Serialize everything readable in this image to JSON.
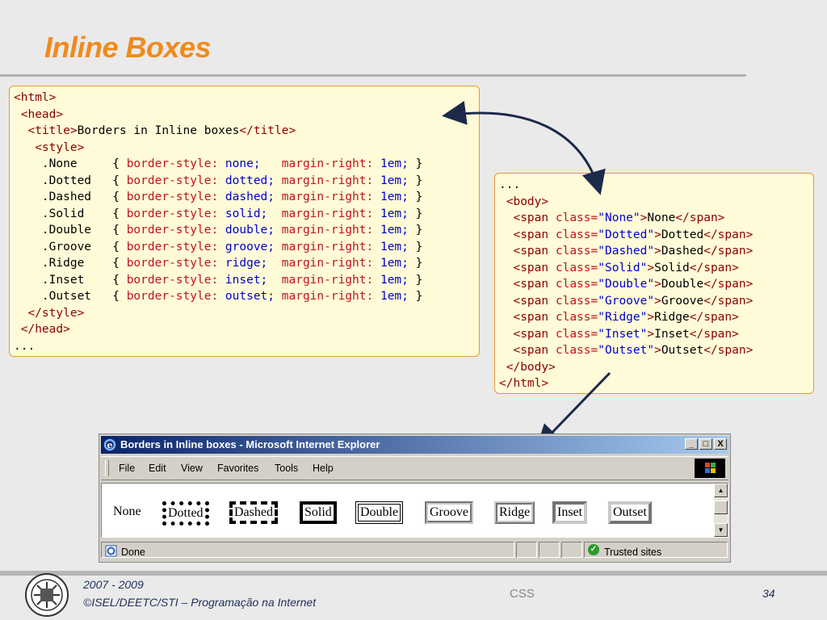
{
  "slide": {
    "title": "Inline Boxes"
  },
  "code_left": [
    [
      [
        "tag",
        "<html>"
      ]
    ],
    [
      [
        "pl",
        " "
      ],
      [
        "tag",
        "<head>"
      ]
    ],
    [
      [
        "pl",
        "  "
      ],
      [
        "tag",
        "<title>"
      ],
      [
        "txt",
        "Borders in Inline boxes"
      ],
      [
        "tag",
        "</title>"
      ]
    ],
    [
      [
        "pl",
        "   "
      ],
      [
        "tag",
        "<style>"
      ]
    ],
    [
      [
        "pl",
        "    .None     { "
      ],
      [
        "attr",
        "border-style: "
      ],
      [
        "val",
        "none;   "
      ],
      [
        "attr",
        "margin-right: "
      ],
      [
        "val",
        "1em;"
      ],
      [
        "pl",
        " }"
      ]
    ],
    [
      [
        "pl",
        "    .Dotted   { "
      ],
      [
        "attr",
        "border-style: "
      ],
      [
        "val",
        "dotted; "
      ],
      [
        "attr",
        "margin-right: "
      ],
      [
        "val",
        "1em;"
      ],
      [
        "pl",
        " }"
      ]
    ],
    [
      [
        "pl",
        "    .Dashed   { "
      ],
      [
        "attr",
        "border-style: "
      ],
      [
        "val",
        "dashed; "
      ],
      [
        "attr",
        "margin-right: "
      ],
      [
        "val",
        "1em;"
      ],
      [
        "pl",
        " }"
      ]
    ],
    [
      [
        "pl",
        "    .Solid    { "
      ],
      [
        "attr",
        "border-style: "
      ],
      [
        "val",
        "solid;  "
      ],
      [
        "attr",
        "margin-right: "
      ],
      [
        "val",
        "1em;"
      ],
      [
        "pl",
        " }"
      ]
    ],
    [
      [
        "pl",
        "    .Double   { "
      ],
      [
        "attr",
        "border-style: "
      ],
      [
        "val",
        "double; "
      ],
      [
        "attr",
        "margin-right: "
      ],
      [
        "val",
        "1em;"
      ],
      [
        "pl",
        " }"
      ]
    ],
    [
      [
        "pl",
        "    .Groove   { "
      ],
      [
        "attr",
        "border-style: "
      ],
      [
        "val",
        "groove; "
      ],
      [
        "attr",
        "margin-right: "
      ],
      [
        "val",
        "1em;"
      ],
      [
        "pl",
        " }"
      ]
    ],
    [
      [
        "pl",
        "    .Ridge    { "
      ],
      [
        "attr",
        "border-style: "
      ],
      [
        "val",
        "ridge;  "
      ],
      [
        "attr",
        "margin-right: "
      ],
      [
        "val",
        "1em;"
      ],
      [
        "pl",
        " }"
      ]
    ],
    [
      [
        "pl",
        "    .Inset    { "
      ],
      [
        "attr",
        "border-style: "
      ],
      [
        "val",
        "inset;  "
      ],
      [
        "attr",
        "margin-right: "
      ],
      [
        "val",
        "1em;"
      ],
      [
        "pl",
        " }"
      ]
    ],
    [
      [
        "pl",
        "    .Outset   { "
      ],
      [
        "attr",
        "border-style: "
      ],
      [
        "val",
        "outset; "
      ],
      [
        "attr",
        "margin-right: "
      ],
      [
        "val",
        "1em;"
      ],
      [
        "pl",
        " }"
      ]
    ],
    [
      [
        "pl",
        "  "
      ],
      [
        "tag",
        "</style>"
      ]
    ],
    [
      [
        "pl",
        " "
      ],
      [
        "tag",
        "</head>"
      ]
    ],
    [
      [
        "pl",
        "..."
      ]
    ]
  ],
  "code_right": [
    [
      [
        "pl",
        "..."
      ]
    ],
    [
      [
        "pl",
        " "
      ],
      [
        "tag",
        "<body>"
      ]
    ],
    [
      [
        "pl",
        "  "
      ],
      [
        "tag",
        "<span "
      ],
      [
        "attr",
        "class="
      ],
      [
        "val",
        "\"None\""
      ],
      [
        "tag",
        ">"
      ],
      [
        "txt",
        "None"
      ],
      [
        "tag",
        "</span>"
      ]
    ],
    [
      [
        "pl",
        "  "
      ],
      [
        "tag",
        "<span "
      ],
      [
        "attr",
        "class="
      ],
      [
        "val",
        "\"Dotted\""
      ],
      [
        "tag",
        ">"
      ],
      [
        "txt",
        "Dotted"
      ],
      [
        "tag",
        "</span>"
      ]
    ],
    [
      [
        "pl",
        "  "
      ],
      [
        "tag",
        "<span "
      ],
      [
        "attr",
        "class="
      ],
      [
        "val",
        "\"Dashed\""
      ],
      [
        "tag",
        ">"
      ],
      [
        "txt",
        "Dashed"
      ],
      [
        "tag",
        "</span>"
      ]
    ],
    [
      [
        "pl",
        "  "
      ],
      [
        "tag",
        "<span "
      ],
      [
        "attr",
        "class="
      ],
      [
        "val",
        "\"Solid\""
      ],
      [
        "tag",
        ">"
      ],
      [
        "txt",
        "Solid"
      ],
      [
        "tag",
        "</span>"
      ]
    ],
    [
      [
        "pl",
        "  "
      ],
      [
        "tag",
        "<span "
      ],
      [
        "attr",
        "class="
      ],
      [
        "val",
        "\"Double\""
      ],
      [
        "tag",
        ">"
      ],
      [
        "txt",
        "Double"
      ],
      [
        "tag",
        "</span>"
      ]
    ],
    [
      [
        "pl",
        "  "
      ],
      [
        "tag",
        "<span "
      ],
      [
        "attr",
        "class="
      ],
      [
        "val",
        "\"Groove\""
      ],
      [
        "tag",
        ">"
      ],
      [
        "txt",
        "Groove"
      ],
      [
        "tag",
        "</span>"
      ]
    ],
    [
      [
        "pl",
        "  "
      ],
      [
        "tag",
        "<span "
      ],
      [
        "attr",
        "class="
      ],
      [
        "val",
        "\"Ridge\""
      ],
      [
        "tag",
        ">"
      ],
      [
        "txt",
        "Ridge"
      ],
      [
        "tag",
        "</span>"
      ]
    ],
    [
      [
        "pl",
        "  "
      ],
      [
        "tag",
        "<span "
      ],
      [
        "attr",
        "class="
      ],
      [
        "val",
        "\"Inset\""
      ],
      [
        "tag",
        ">"
      ],
      [
        "txt",
        "Inset"
      ],
      [
        "tag",
        "</span>"
      ]
    ],
    [
      [
        "pl",
        "  "
      ],
      [
        "tag",
        "<span "
      ],
      [
        "attr",
        "class="
      ],
      [
        "val",
        "\"Outset\""
      ],
      [
        "tag",
        ">"
      ],
      [
        "txt",
        "Outset"
      ],
      [
        "tag",
        "</span>"
      ]
    ],
    [
      [
        "pl",
        " "
      ],
      [
        "tag",
        "</body>"
      ]
    ],
    [
      [
        "tag",
        "</html>"
      ]
    ]
  ],
  "browser": {
    "title": "Borders in Inline boxes - Microsoft Internet Explorer",
    "window_buttons": {
      "minimize": "_",
      "maximize": "□",
      "close": "X"
    },
    "menu": [
      "File",
      "Edit",
      "View",
      "Favorites",
      "Tools",
      "Help"
    ],
    "demo": {
      "none": "None",
      "dotted": "Dotted",
      "dashed": "Dashed",
      "solid": "Solid",
      "double": "Double",
      "groove": "Groove",
      "ridge": "Ridge",
      "inset": "Inset",
      "outset": "Outset"
    },
    "status": {
      "left": "Done",
      "zone": "Trusted sites"
    }
  },
  "footer": {
    "years": "2007 - 2009",
    "course": "©ISEL/DEETC/STI – Programação na Internet",
    "topic": "CSS",
    "page": "34"
  },
  "colors": {
    "title": "#f08a1c",
    "code_bg": "#fffbd8",
    "code_border": "#e59a2e",
    "tag": "#8b0000",
    "attr": "#c1121f",
    "value": "#0000cc",
    "arrow": "#1c2a4a"
  },
  "icons": [
    "ie-logo-icon",
    "windows-flag-icon",
    "page-icon",
    "checkmark-icon",
    "school-logo-icon",
    "double-arrow-icon",
    "arrow-icon"
  ]
}
